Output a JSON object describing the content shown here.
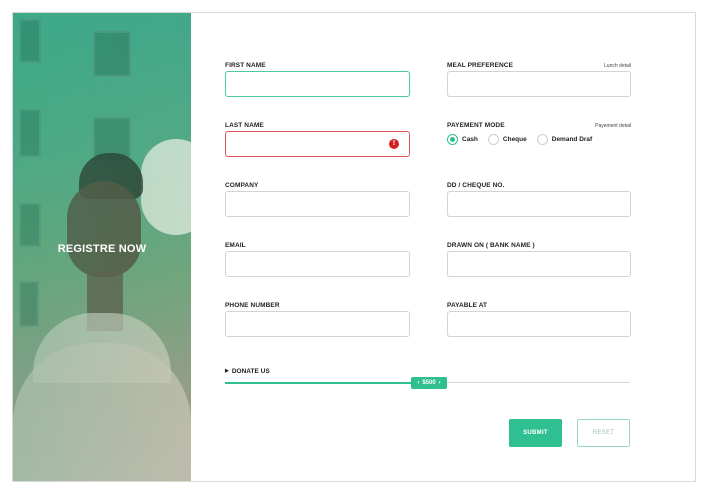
{
  "banner": {
    "title": "REGISTRE NOW"
  },
  "form": {
    "first_name": {
      "label": "FIRST NAME",
      "value": ""
    },
    "last_name": {
      "label": "LAST NAME",
      "value": ""
    },
    "company": {
      "label": "COMPANY",
      "value": ""
    },
    "email": {
      "label": "EMAIL",
      "value": ""
    },
    "phone": {
      "label": "PHONE NUMBER",
      "value": ""
    },
    "meal": {
      "label": "MEAL PREFERENCE",
      "helper": "Lunch detail",
      "value": ""
    },
    "payment_mode": {
      "label": "PAYEMENT MODE",
      "helper": "Payement detail",
      "options": [
        "Cash",
        "Cheque",
        "Demand Draf"
      ],
      "selected": "Cash"
    },
    "dd_cheque": {
      "label": "DD / CHEQUE NO.",
      "value": ""
    },
    "drawn_on": {
      "label": "DRAWN ON ( BANK NAME )",
      "value": ""
    },
    "payable_at": {
      "label": "PAYABLE AT",
      "value": ""
    },
    "donate": {
      "label": "DONATE US",
      "value_text": "$500",
      "fraction": 0.46
    },
    "submit_label": "SUBMIT",
    "reset_label": "RESET",
    "accent_color": "#2fbf90",
    "error_color": "#d42020"
  }
}
